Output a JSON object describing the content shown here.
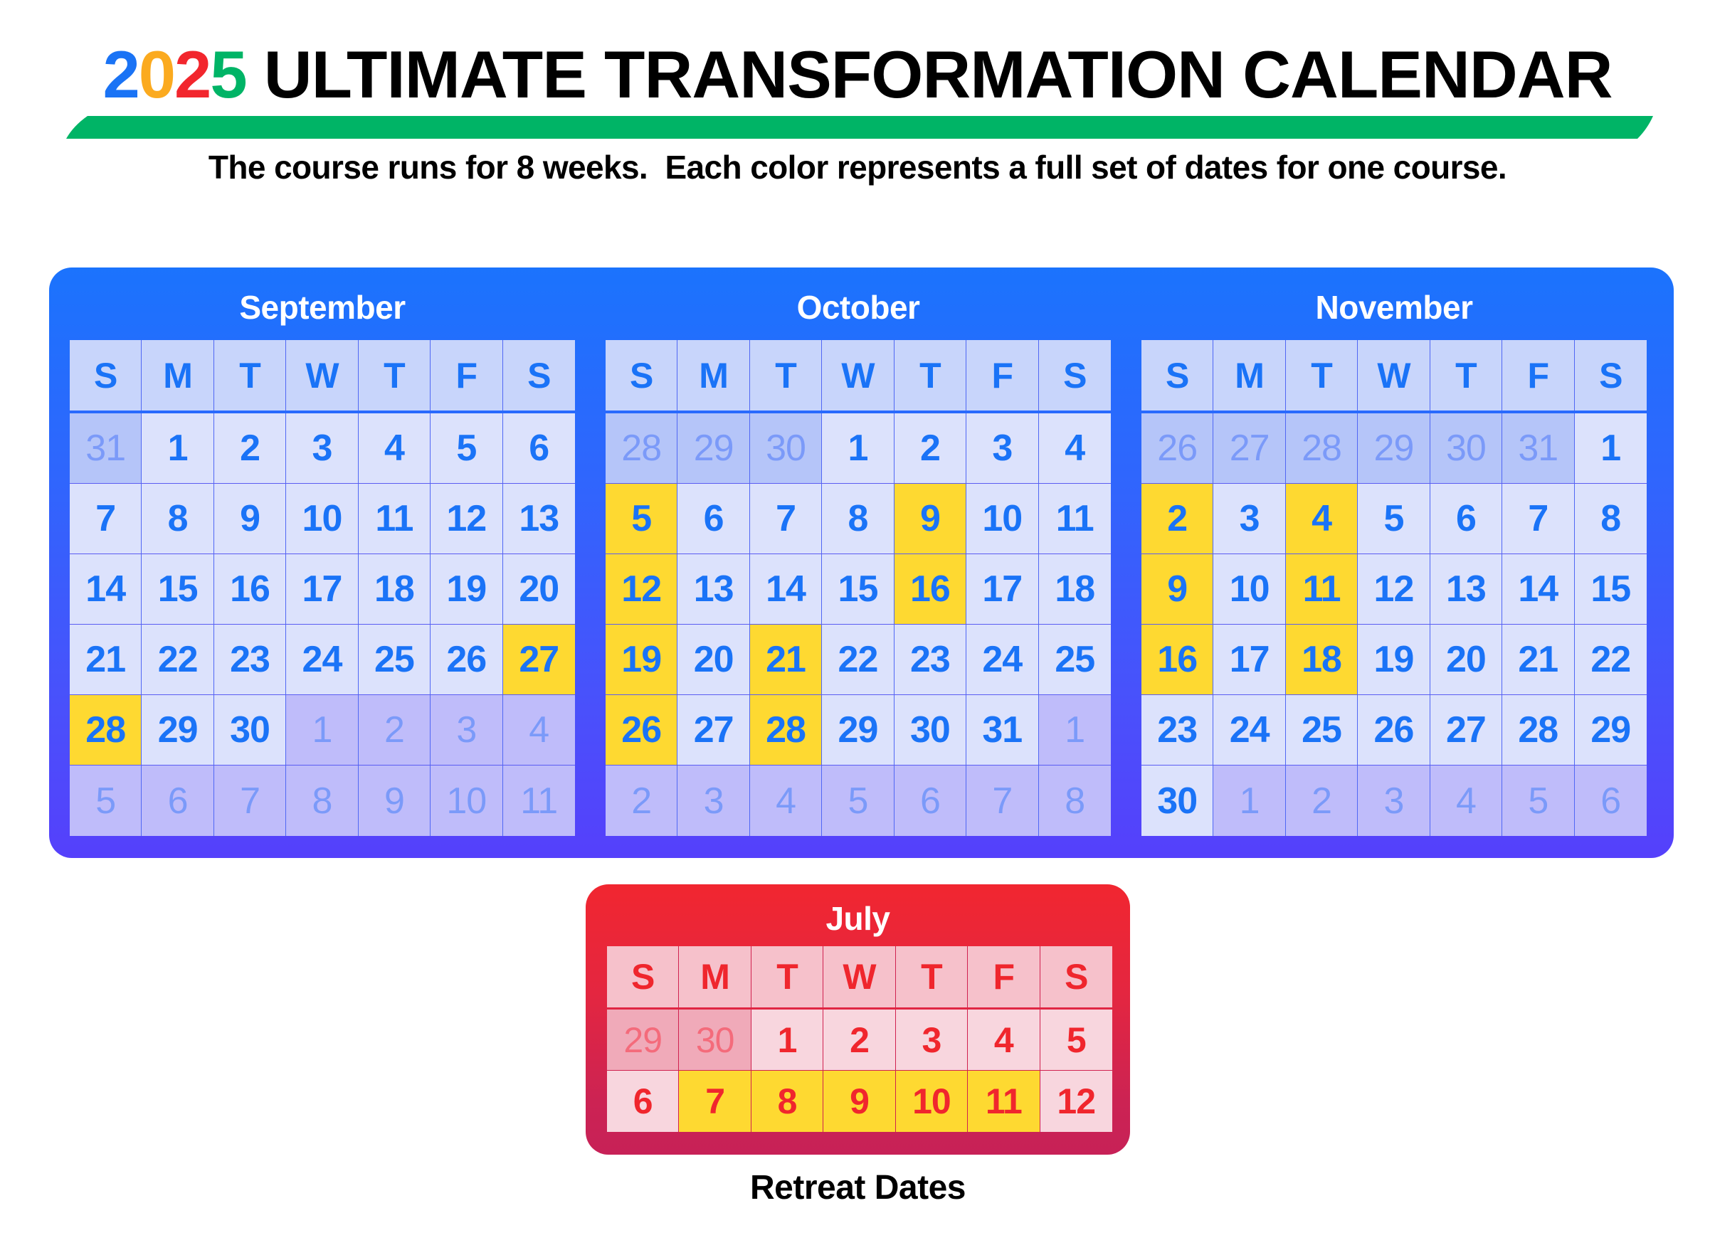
{
  "title": {
    "year_digits": [
      {
        "char": "2",
        "color": "#1a73f5"
      },
      {
        "char": "0",
        "color": "#fbaa1f"
      },
      {
        "char": "2",
        "color": "#f2262d"
      },
      {
        "char": "5",
        "color": "#00b466"
      }
    ],
    "text": " ULTIMATE TRANSFORMATION CALENDAR"
  },
  "accent_colors": {
    "green_bar": "#00b466",
    "course_panel": "#2f66fd",
    "retreat_panel": "#e42640",
    "highlight": "#fed931"
  },
  "subtitle": "The course runs for 8 weeks.  Each color represents a full set of dates for one course.",
  "weekday_labels": [
    "S",
    "M",
    "T",
    "W",
    "T",
    "F",
    "S"
  ],
  "course_months": [
    {
      "name": "September",
      "weeks": [
        [
          {
            "d": "31",
            "t": "other"
          },
          {
            "d": "1"
          },
          {
            "d": "2"
          },
          {
            "d": "3"
          },
          {
            "d": "4"
          },
          {
            "d": "5"
          },
          {
            "d": "6"
          }
        ],
        [
          {
            "d": "7"
          },
          {
            "d": "8"
          },
          {
            "d": "9"
          },
          {
            "d": "10"
          },
          {
            "d": "11"
          },
          {
            "d": "12"
          },
          {
            "d": "13"
          }
        ],
        [
          {
            "d": "14"
          },
          {
            "d": "15"
          },
          {
            "d": "16"
          },
          {
            "d": "17"
          },
          {
            "d": "18"
          },
          {
            "d": "19"
          },
          {
            "d": "20"
          }
        ],
        [
          {
            "d": "21"
          },
          {
            "d": "22"
          },
          {
            "d": "23"
          },
          {
            "d": "24"
          },
          {
            "d": "25"
          },
          {
            "d": "26"
          },
          {
            "d": "27",
            "t": "hl"
          }
        ],
        [
          {
            "d": "28",
            "t": "hl"
          },
          {
            "d": "29"
          },
          {
            "d": "30"
          },
          {
            "d": "1",
            "t": "other"
          },
          {
            "d": "2",
            "t": "other"
          },
          {
            "d": "3",
            "t": "other"
          },
          {
            "d": "4",
            "t": "other"
          }
        ],
        [
          {
            "d": "5",
            "t": "other"
          },
          {
            "d": "6",
            "t": "other"
          },
          {
            "d": "7",
            "t": "other"
          },
          {
            "d": "8",
            "t": "other"
          },
          {
            "d": "9",
            "t": "other"
          },
          {
            "d": "10",
            "t": "other"
          },
          {
            "d": "11",
            "t": "other"
          }
        ]
      ]
    },
    {
      "name": "October",
      "weeks": [
        [
          {
            "d": "28",
            "t": "other"
          },
          {
            "d": "29",
            "t": "other"
          },
          {
            "d": "30",
            "t": "other"
          },
          {
            "d": "1"
          },
          {
            "d": "2"
          },
          {
            "d": "3"
          },
          {
            "d": "4"
          }
        ],
        [
          {
            "d": "5",
            "t": "hl"
          },
          {
            "d": "6"
          },
          {
            "d": "7"
          },
          {
            "d": "8"
          },
          {
            "d": "9",
            "t": "hl"
          },
          {
            "d": "10"
          },
          {
            "d": "11"
          }
        ],
        [
          {
            "d": "12",
            "t": "hl"
          },
          {
            "d": "13"
          },
          {
            "d": "14"
          },
          {
            "d": "15"
          },
          {
            "d": "16",
            "t": "hl"
          },
          {
            "d": "17"
          },
          {
            "d": "18"
          }
        ],
        [
          {
            "d": "19",
            "t": "hl"
          },
          {
            "d": "20"
          },
          {
            "d": "21",
            "t": "hl"
          },
          {
            "d": "22"
          },
          {
            "d": "23"
          },
          {
            "d": "24"
          },
          {
            "d": "25"
          }
        ],
        [
          {
            "d": "26",
            "t": "hl"
          },
          {
            "d": "27"
          },
          {
            "d": "28",
            "t": "hl"
          },
          {
            "d": "29"
          },
          {
            "d": "30"
          },
          {
            "d": "31"
          },
          {
            "d": "1",
            "t": "other"
          }
        ],
        [
          {
            "d": "2",
            "t": "other"
          },
          {
            "d": "3",
            "t": "other"
          },
          {
            "d": "4",
            "t": "other"
          },
          {
            "d": "5",
            "t": "other"
          },
          {
            "d": "6",
            "t": "other"
          },
          {
            "d": "7",
            "t": "other"
          },
          {
            "d": "8",
            "t": "other"
          }
        ]
      ]
    },
    {
      "name": "November",
      "weeks": [
        [
          {
            "d": "26",
            "t": "other"
          },
          {
            "d": "27",
            "t": "other"
          },
          {
            "d": "28",
            "t": "other"
          },
          {
            "d": "29",
            "t": "other"
          },
          {
            "d": "30",
            "t": "other"
          },
          {
            "d": "31",
            "t": "other"
          },
          {
            "d": "1"
          }
        ],
        [
          {
            "d": "2",
            "t": "hl"
          },
          {
            "d": "3"
          },
          {
            "d": "4",
            "t": "hl"
          },
          {
            "d": "5"
          },
          {
            "d": "6"
          },
          {
            "d": "7"
          },
          {
            "d": "8"
          }
        ],
        [
          {
            "d": "9",
            "t": "hl"
          },
          {
            "d": "10"
          },
          {
            "d": "11",
            "t": "hl"
          },
          {
            "d": "12"
          },
          {
            "d": "13"
          },
          {
            "d": "14"
          },
          {
            "d": "15"
          }
        ],
        [
          {
            "d": "16",
            "t": "hl"
          },
          {
            "d": "17"
          },
          {
            "d": "18",
            "t": "hl"
          },
          {
            "d": "19"
          },
          {
            "d": "20"
          },
          {
            "d": "21"
          },
          {
            "d": "22"
          }
        ],
        [
          {
            "d": "23"
          },
          {
            "d": "24"
          },
          {
            "d": "25"
          },
          {
            "d": "26"
          },
          {
            "d": "27"
          },
          {
            "d": "28"
          },
          {
            "d": "29"
          }
        ],
        [
          {
            "d": "30"
          },
          {
            "d": "1",
            "t": "other"
          },
          {
            "d": "2",
            "t": "other"
          },
          {
            "d": "3",
            "t": "other"
          },
          {
            "d": "4",
            "t": "other"
          },
          {
            "d": "5",
            "t": "other"
          },
          {
            "d": "6",
            "t": "other"
          }
        ]
      ]
    }
  ],
  "retreat_month": {
    "name": "July",
    "weeks": [
      [
        {
          "d": "29",
          "t": "other"
        },
        {
          "d": "30",
          "t": "other"
        },
        {
          "d": "1"
        },
        {
          "d": "2"
        },
        {
          "d": "3"
        },
        {
          "d": "4"
        },
        {
          "d": "5"
        }
      ],
      [
        {
          "d": "6"
        },
        {
          "d": "7",
          "t": "hl"
        },
        {
          "d": "8",
          "t": "hl"
        },
        {
          "d": "9",
          "t": "hl"
        },
        {
          "d": "10",
          "t": "hl"
        },
        {
          "d": "11",
          "t": "hl"
        },
        {
          "d": "12"
        }
      ]
    ]
  },
  "retreat_caption": "Retreat Dates"
}
